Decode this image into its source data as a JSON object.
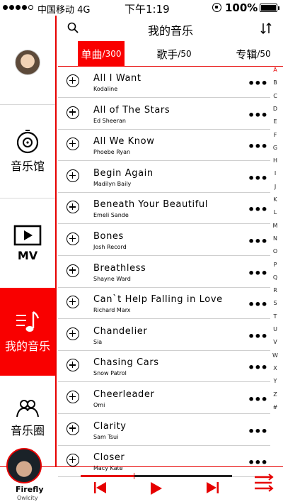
{
  "status": {
    "carrier": "中国移动",
    "network": "4G",
    "time": "下午1:19",
    "battery": "100%",
    "signal_bars": 4
  },
  "sidebar": {
    "items": [
      {
        "label": "音乐馆",
        "icon": "record-icon"
      },
      {
        "label": "MV",
        "icon": "video-play-icon"
      },
      {
        "label": "我的音乐",
        "icon": "music-note-list-icon"
      },
      {
        "label": "音乐圈",
        "icon": "people-icon"
      }
    ]
  },
  "header": {
    "title": "我的音乐"
  },
  "tabs": [
    {
      "label": "单曲",
      "count": "/300",
      "active": true
    },
    {
      "label": "歌手",
      "count": "/50",
      "active": false
    },
    {
      "label": "专辑",
      "count": "/50",
      "active": false
    }
  ],
  "songs": [
    {
      "title": "All I Want",
      "artist": "Kodaline"
    },
    {
      "title": "All of The Stars",
      "artist": "Ed Sheeran"
    },
    {
      "title": "All We Know",
      "artist": "Phoebe Ryan"
    },
    {
      "title": "Begin Again",
      "artist": "Madilyn Baily"
    },
    {
      "title": "Beneath Your Beautiful",
      "artist": "Emeli Sande"
    },
    {
      "title": "Bones",
      "artist": "Josh Record"
    },
    {
      "title": "Breathless",
      "artist": "Shayne Ward"
    },
    {
      "title": "Can`t Help Falling in Love",
      "artist": "Richard Marx"
    },
    {
      "title": "Chandelier",
      "artist": "Sia"
    },
    {
      "title": "Chasing Cars",
      "artist": "Snow Patrol"
    },
    {
      "title": "Cheerleader",
      "artist": "Omi"
    },
    {
      "title": "Clarity",
      "artist": "Sam Tsui"
    },
    {
      "title": "Closer",
      "artist": "Macy Kate"
    }
  ],
  "more_label": "•••",
  "alphabet": [
    "A",
    "B",
    "C",
    "D",
    "E",
    "F",
    "G",
    "H",
    "I",
    "J",
    "K",
    "L",
    "M",
    "N",
    "O",
    "P",
    "Q",
    "R",
    "S",
    "T",
    "U",
    "V",
    "W",
    "X",
    "Y",
    "Z",
    "#"
  ],
  "alphabet_active": "A",
  "now_playing": {
    "title": "Firefly",
    "artist": "Owlcity",
    "progress": 0.35
  },
  "colors": {
    "accent": "#f90000"
  }
}
